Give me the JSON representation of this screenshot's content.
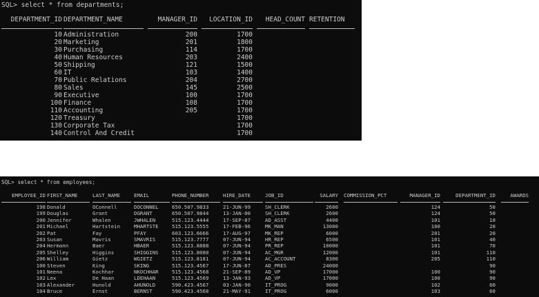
{
  "window1": {
    "prompt": "SQL> select * from departments;",
    "columns": [
      "DEPARTMENT_ID",
      "DEPARTMENT_NAME",
      "MANAGER_ID",
      "LOCATION_ID",
      "HEAD_COUNT",
      "RETENTION"
    ],
    "rows": [
      [
        "10",
        "Administration",
        "200",
        "1700",
        "",
        ""
      ],
      [
        "20",
        "Marketing",
        "201",
        "1800",
        "",
        ""
      ],
      [
        "30",
        "Purchasing",
        "114",
        "1700",
        "",
        ""
      ],
      [
        "40",
        "Human Resources",
        "203",
        "2400",
        "",
        ""
      ],
      [
        "50",
        "Shipping",
        "121",
        "1500",
        "",
        ""
      ],
      [
        "60",
        "IT",
        "103",
        "1400",
        "",
        ""
      ],
      [
        "70",
        "Public Relations",
        "204",
        "2700",
        "",
        ""
      ],
      [
        "80",
        "Sales",
        "145",
        "2500",
        "",
        ""
      ],
      [
        "90",
        "Executive",
        "100",
        "1700",
        "",
        ""
      ],
      [
        "100",
        "Finance",
        "108",
        "1700",
        "",
        ""
      ],
      [
        "110",
        "Accounting",
        "205",
        "1700",
        "",
        ""
      ],
      [
        "120",
        "Treasury",
        "",
        "1700",
        "",
        ""
      ],
      [
        "130",
        "Corporate Tax",
        "",
        "1700",
        "",
        ""
      ],
      [
        "140",
        "Control And Credit",
        "",
        "1700",
        "",
        ""
      ]
    ]
  },
  "window2": {
    "prompt": "SQL> select * from employees;",
    "columns": [
      "EMPLOYEE_ID",
      "FIRST_NAME",
      "LAST_NAME",
      "EMAIL",
      "PHONE_NUMBER",
      "HIRE_DATE",
      "JOB_ID",
      "SALARY",
      "COMMISSION_PCT",
      "MANAGER_ID",
      "DEPARTMENT_ID",
      "AWARDS"
    ],
    "rows": [
      [
        "198",
        "Donald",
        "OConnell",
        "DOCONNEL",
        "650.507.9833",
        "21-JUN-99",
        "SH_CLERK",
        "2600",
        "",
        "124",
        "50",
        ""
      ],
      [
        "199",
        "Douglas",
        "Grant",
        "DGRANT",
        "650.507.9844",
        "13-JAN-00",
        "SH_CLERK",
        "2600",
        "",
        "124",
        "50",
        ""
      ],
      [
        "200",
        "Jennifer",
        "Whalen",
        "JWHALEN",
        "515.123.4444",
        "17-SEP-87",
        "AD_ASST",
        "4400",
        "",
        "101",
        "10",
        ""
      ],
      [
        "201",
        "Michael",
        "Hartstein",
        "MHARTSTE",
        "515.123.5555",
        "17-FEB-96",
        "MK_MAN",
        "13000",
        "",
        "100",
        "20",
        ""
      ],
      [
        "202",
        "Pat",
        "Fay",
        "PFAY",
        "603.123.6666",
        "17-AUG-97",
        "MK_REP",
        "6000",
        "",
        "201",
        "20",
        ""
      ],
      [
        "203",
        "Susan",
        "Mavris",
        "SMAVRIS",
        "515.123.7777",
        "07-JUN-94",
        "HR_REP",
        "6500",
        "",
        "101",
        "40",
        ""
      ],
      [
        "204",
        "Hermann",
        "Baer",
        "HBAER",
        "515.123.8888",
        "07-JUN-94",
        "PR_REP",
        "10000",
        "",
        "101",
        "70",
        ""
      ],
      [
        "205",
        "Shelley",
        "Higgins",
        "SHIGGINS",
        "515.123.8080",
        "07-JUN-94",
        "AC_MGR",
        "12000",
        "",
        "101",
        "110",
        ""
      ],
      [
        "206",
        "William",
        "Gietz",
        "WGIETZ",
        "515.123.8181",
        "07-JUN-94",
        "AC_ACCOUNT",
        "8300",
        "",
        "205",
        "110",
        ""
      ],
      [
        "100",
        "Steven",
        "King",
        "SKING",
        "515.123.4567",
        "17-JUN-87",
        "AD_PRES",
        "24000",
        "",
        "",
        "90",
        ""
      ],
      [
        "101",
        "Neena",
        "Kochhar",
        "NKOCHHAR",
        "515.123.4568",
        "21-SEP-89",
        "AD_VP",
        "17000",
        "",
        "100",
        "90",
        ""
      ],
      [
        "102",
        "Lex",
        "De Haan",
        "LDEHAAN",
        "515.123.4569",
        "13-JAN-93",
        "AD_VP",
        "17000",
        "",
        "100",
        "90",
        ""
      ],
      [
        "103",
        "Alexander",
        "Hunold",
        "AHUNOLD",
        "590.423.4567",
        "03-JAN-90",
        "IT_PROG",
        "9000",
        "",
        "102",
        "60",
        ""
      ],
      [
        "104",
        "Bruce",
        "Ernst",
        "BERNST",
        "590.423.4568",
        "21-MAY-91",
        "IT_PROG",
        "6000",
        "",
        "103",
        "60",
        ""
      ]
    ]
  }
}
